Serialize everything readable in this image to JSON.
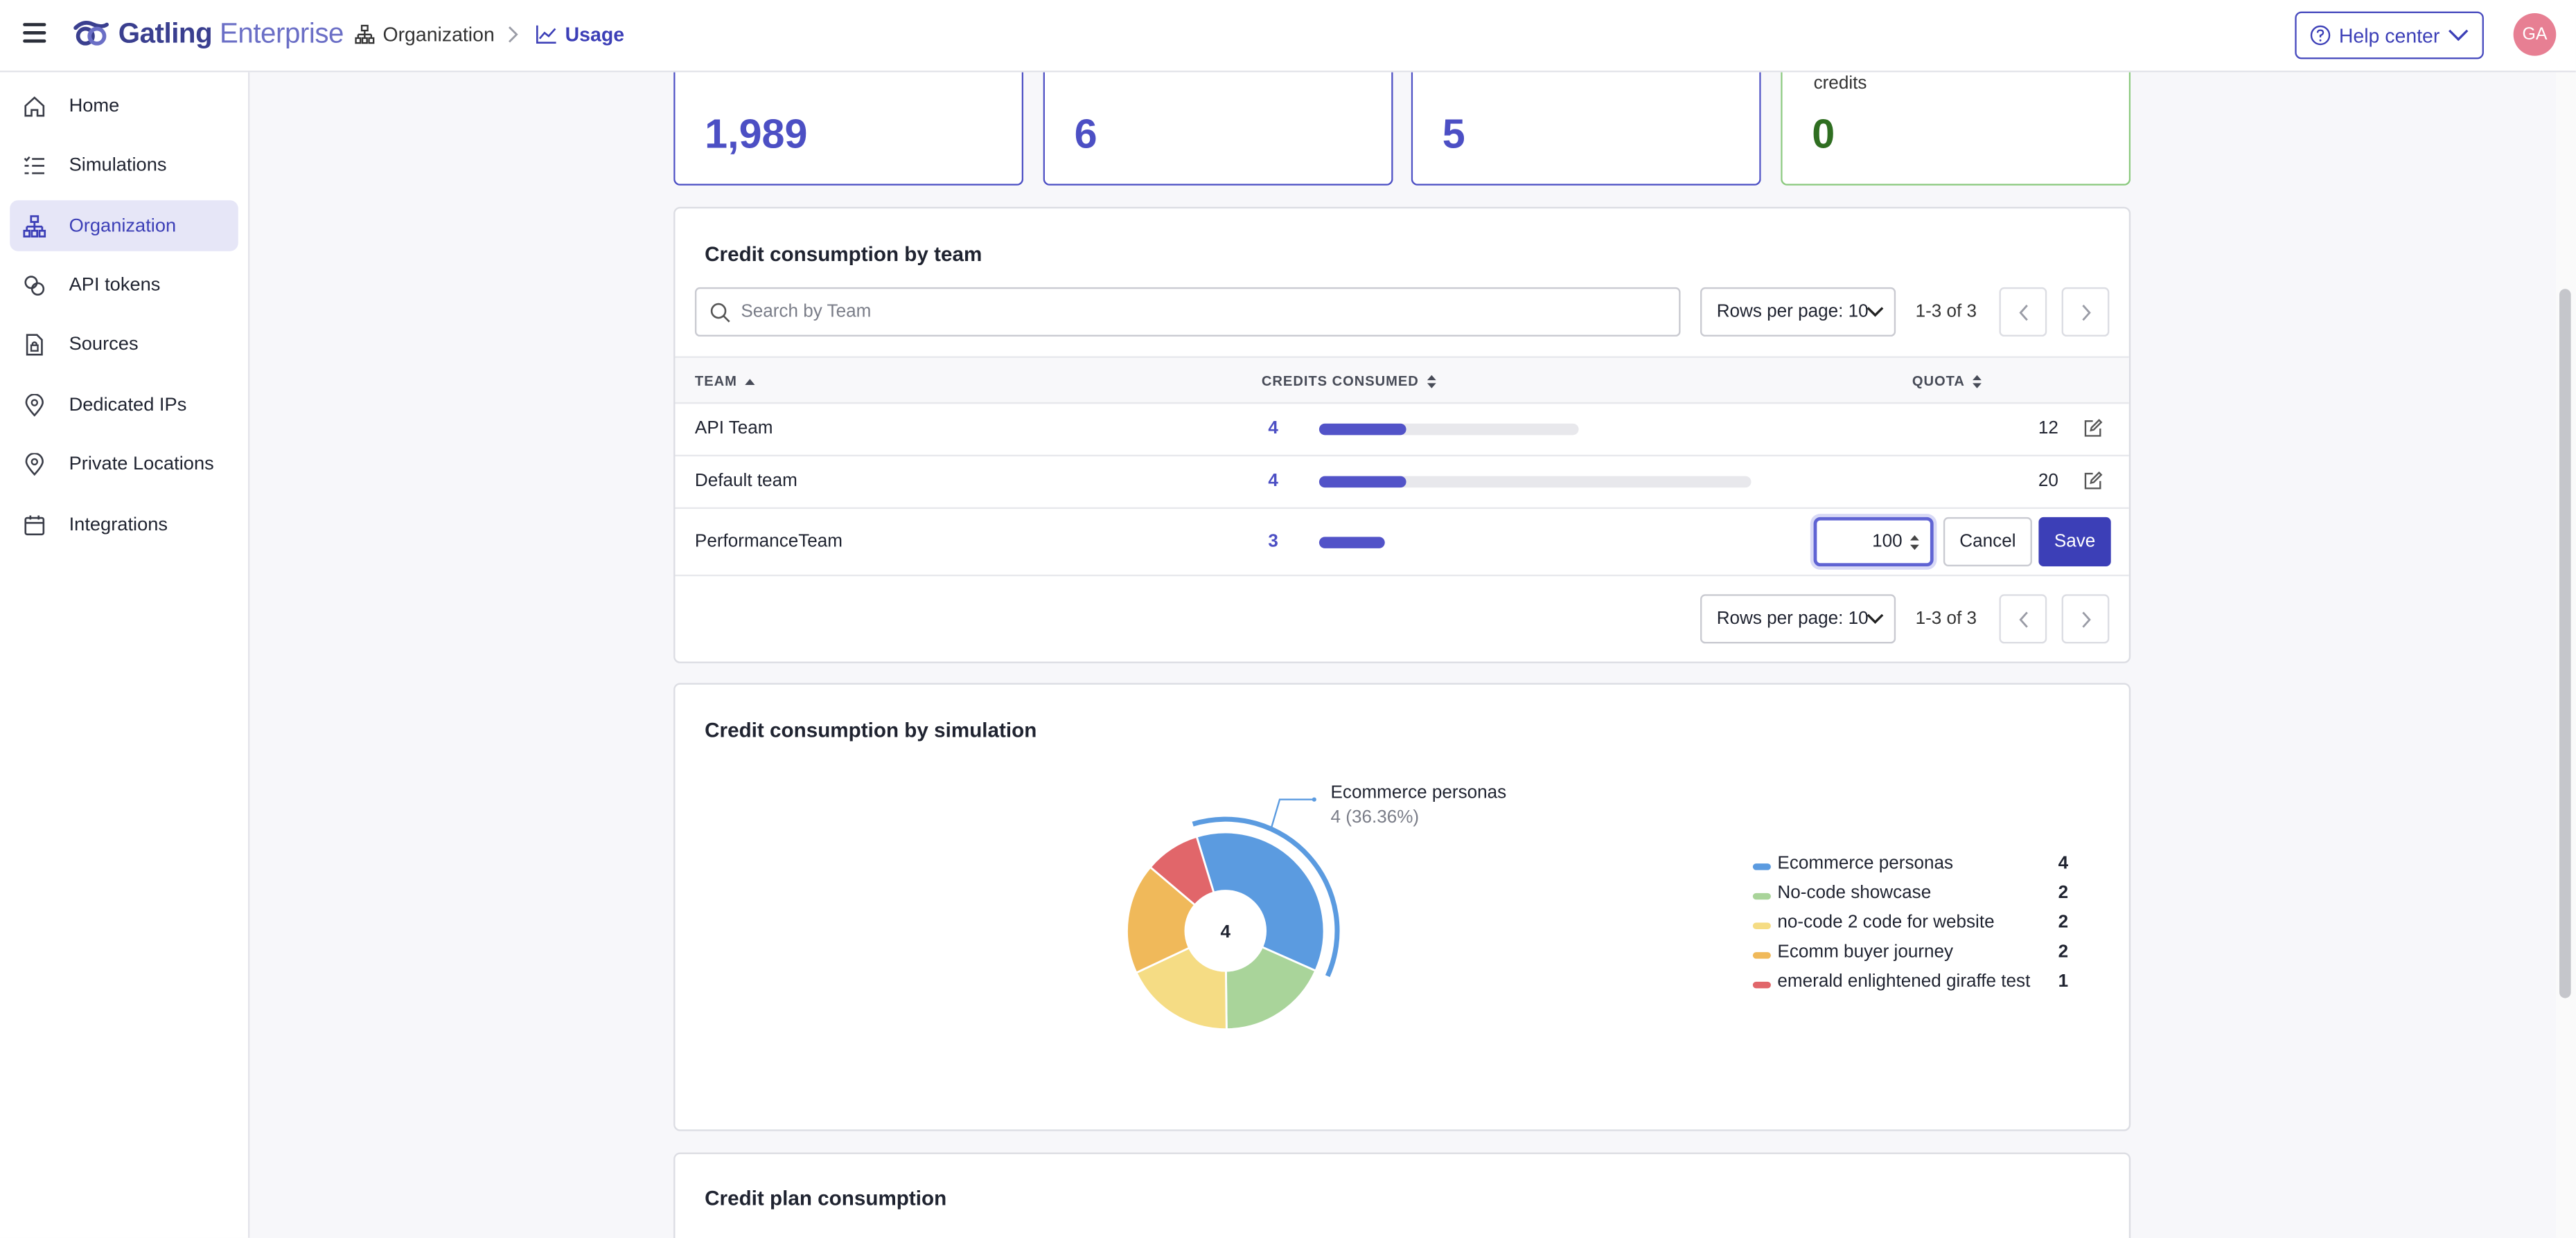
{
  "app": {
    "brand_bold": "Gatling",
    "brand_light": "Enterprise",
    "breadcrumb": [
      {
        "label": "Organization",
        "icon": "org-chart-icon"
      },
      {
        "label": "Usage",
        "icon": "line-chart-icon"
      }
    ],
    "help_label": "Help center",
    "avatar_initials": "GA"
  },
  "sidebar": {
    "items": [
      {
        "label": "Home",
        "icon": "home-icon",
        "active": false
      },
      {
        "label": "Simulations",
        "icon": "list-icon",
        "active": false
      },
      {
        "label": "Organization",
        "icon": "org-chart-icon",
        "active": true
      },
      {
        "label": "API tokens",
        "icon": "token-icon",
        "active": false
      },
      {
        "label": "Sources",
        "icon": "file-lock-icon",
        "active": false
      },
      {
        "label": "Dedicated IPs",
        "icon": "location-pin-icon",
        "active": false
      },
      {
        "label": "Private Locations",
        "icon": "location-pin-icon",
        "active": false
      },
      {
        "label": "Integrations",
        "icon": "calendar-icon",
        "active": false
      }
    ]
  },
  "stats": [
    {
      "value": "1,989",
      "label": ""
    },
    {
      "value": "6",
      "label": ""
    },
    {
      "value": "5",
      "label": ""
    },
    {
      "value": "0",
      "label": "credits"
    }
  ],
  "teams_panel": {
    "title": "Credit consumption by team",
    "search_placeholder": "Search by Team",
    "rows_per_page": "Rows per page: 10",
    "page_info": "1-3 of 3",
    "columns": {
      "team": "TEAM",
      "credits": "CREDITS CONSUMED",
      "quota": "QUOTA"
    },
    "rows": [
      {
        "team": "API Team",
        "credits": "4",
        "quota": "12",
        "fraction": 0.3333
      },
      {
        "team": "Default team",
        "credits": "4",
        "quota": "20",
        "fraction": 0.2
      },
      {
        "team": "PerformanceTeam",
        "credits": "3",
        "quota": "100",
        "fraction": 0.03,
        "editing": true
      }
    ],
    "cancel_label": "Cancel",
    "save_label": "Save"
  },
  "simulation_panel": {
    "title": "Credit consumption by simulation",
    "center_label": "4",
    "callout_name": "Ecommerce personas",
    "callout_value": "4 (36.36%)"
  },
  "chart_data": {
    "type": "pie",
    "title": "Credit consumption by simulation",
    "legend_position": "right",
    "center_value": 4,
    "highlighted": "Ecommerce personas",
    "slices": [
      {
        "name": "Ecommerce personas",
        "value": 4,
        "color": "#5b9be0"
      },
      {
        "name": "No-code showcase",
        "value": 2,
        "color": "#a9d49a"
      },
      {
        "name": "no-code 2 code for website",
        "value": 2,
        "color": "#f5dc84"
      },
      {
        "name": "Ecomm buyer journey",
        "value": 2,
        "color": "#f0b95a"
      },
      {
        "name": "emerald enlightened giraffe test",
        "value": 1,
        "color": "#e1666a"
      }
    ]
  },
  "plan_panel": {
    "title": "Credit plan consumption"
  }
}
